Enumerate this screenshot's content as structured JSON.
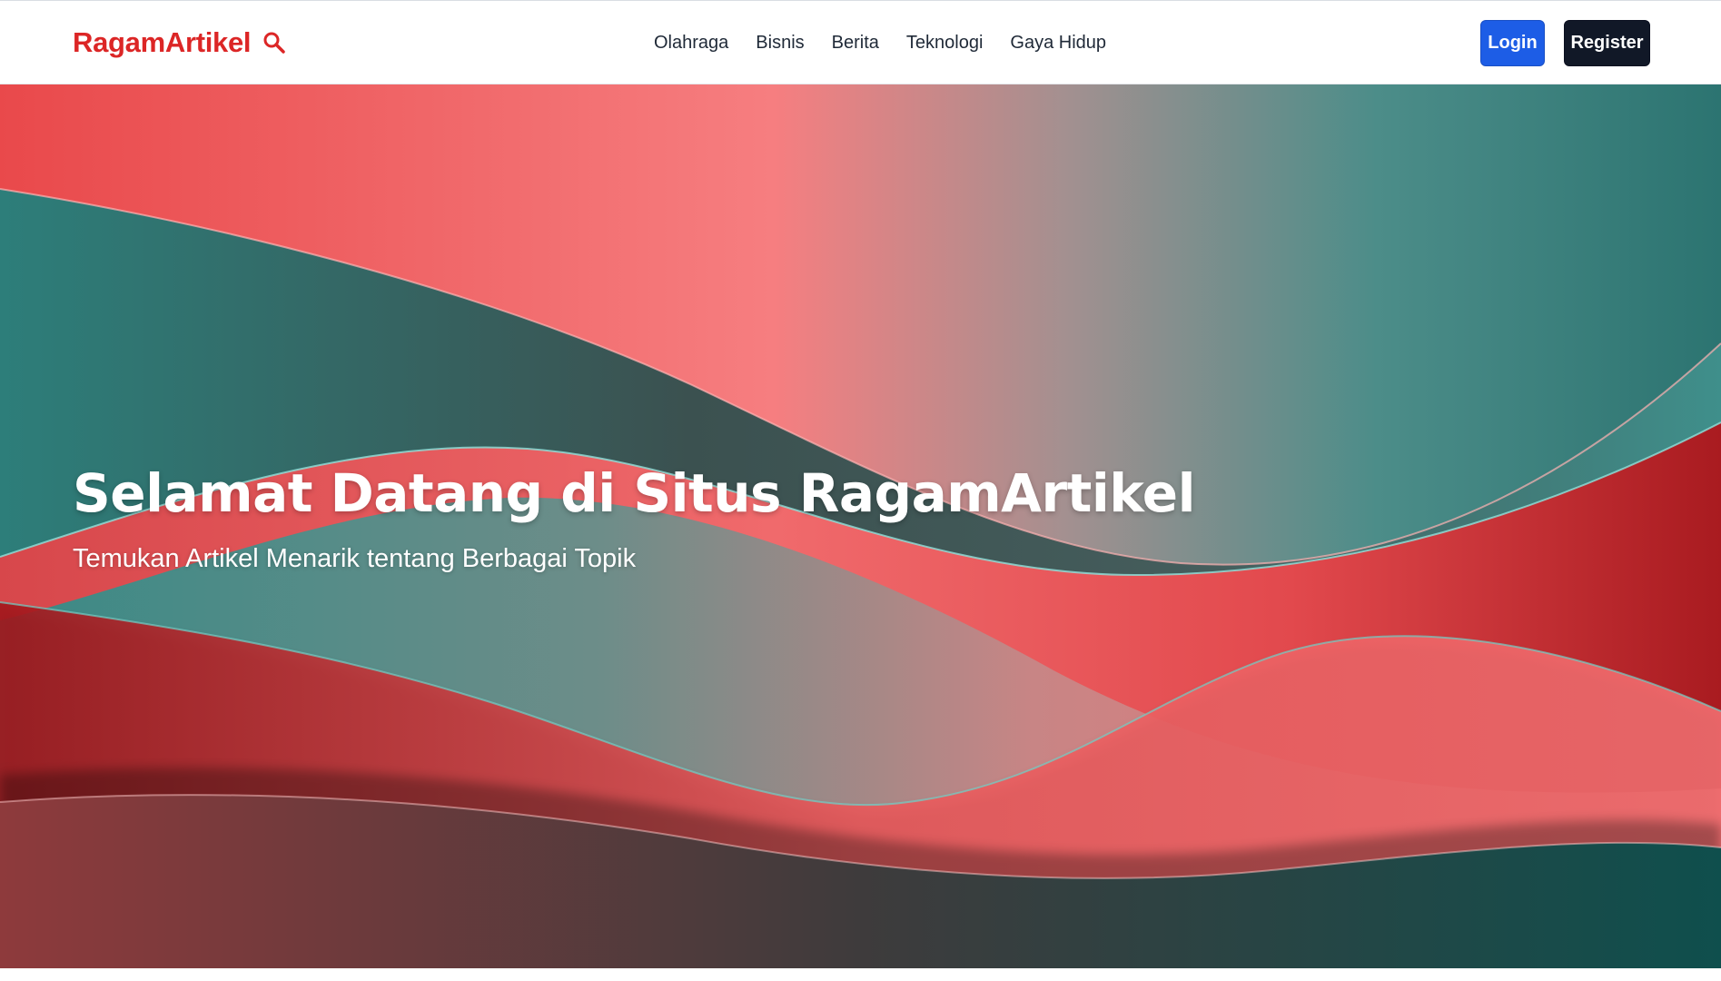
{
  "header": {
    "brand": "RagamArtikel",
    "search_icon": "search-icon",
    "nav": [
      {
        "label": "Olahraga"
      },
      {
        "label": "Bisnis"
      },
      {
        "label": "Berita"
      },
      {
        "label": "Teknologi"
      },
      {
        "label": "Gaya Hidup"
      }
    ],
    "login_label": "Login",
    "register_label": "Register"
  },
  "hero": {
    "title": "Selamat Datang di Situs RagamArtikel",
    "subtitle": "Temukan Artikel Menarik tentang Berbagai Topik"
  },
  "colors": {
    "brand": "#dc2626",
    "login_button": "#1d5de6",
    "register_button": "#111827",
    "teal": "#2f7f7b",
    "coral": "#f47c7c",
    "crimson": "#b31d22"
  }
}
